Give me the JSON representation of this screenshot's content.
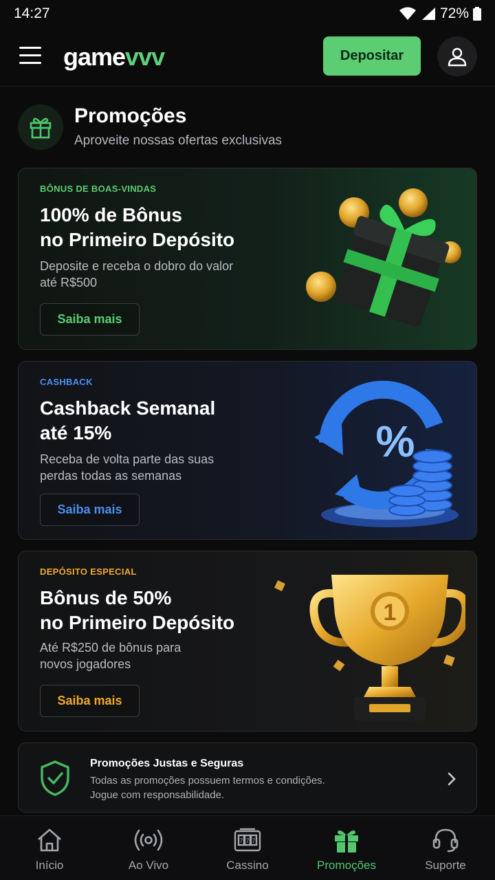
{
  "status_bar": {
    "time": "14:27",
    "battery": "72%"
  },
  "header": {
    "logo_part1": "game",
    "logo_part2": "vvv",
    "deposit_label": "Depositar"
  },
  "page": {
    "title": "Promoções",
    "subtitle": "Aproveite nossas ofertas exclusivas"
  },
  "promotions": [
    {
      "tag": "BÔNUS DE BOAS-VINDAS",
      "title_line1": "100% de Bônus",
      "title_line2": "no Primeiro Depósito",
      "desc_line1": "Deposite e receba o dobro do valor",
      "desc_line2": "até R$500",
      "button": "Saiba mais",
      "accent": "#5ccd73"
    },
    {
      "tag": "CASHBACK",
      "title_line1": "Cashback Semanal",
      "title_line2": "até 15%",
      "desc_line1": "Receba de volta parte das suas",
      "desc_line2": "perdas todas as semanas",
      "button": "Saiba mais",
      "accent": "#4a8ff0"
    },
    {
      "tag": "DEPÓSITO ESPECIAL",
      "title_line1": "Bônus de 50%",
      "title_line2": "no Primeiro Depósito",
      "desc_line1": "Até R$250 de bônus para",
      "desc_line2": "novos jogadores",
      "button": "Saiba mais",
      "accent": "#f0a82a"
    }
  ],
  "safety": {
    "title": "Promoções Justas e Seguras",
    "text_line1": "Todas as promoções possuem termos e condições.",
    "text_line2": "Jogue com responsabilidade."
  },
  "nav": [
    {
      "label": "Início",
      "icon": "home-icon",
      "active": false
    },
    {
      "label": "Ao Vivo",
      "icon": "live-icon",
      "active": false
    },
    {
      "label": "Cassino",
      "icon": "slot-icon",
      "active": false
    },
    {
      "label": "Promoções",
      "icon": "gift-icon",
      "active": true
    },
    {
      "label": "Suporte",
      "icon": "headset-icon",
      "active": false
    }
  ]
}
